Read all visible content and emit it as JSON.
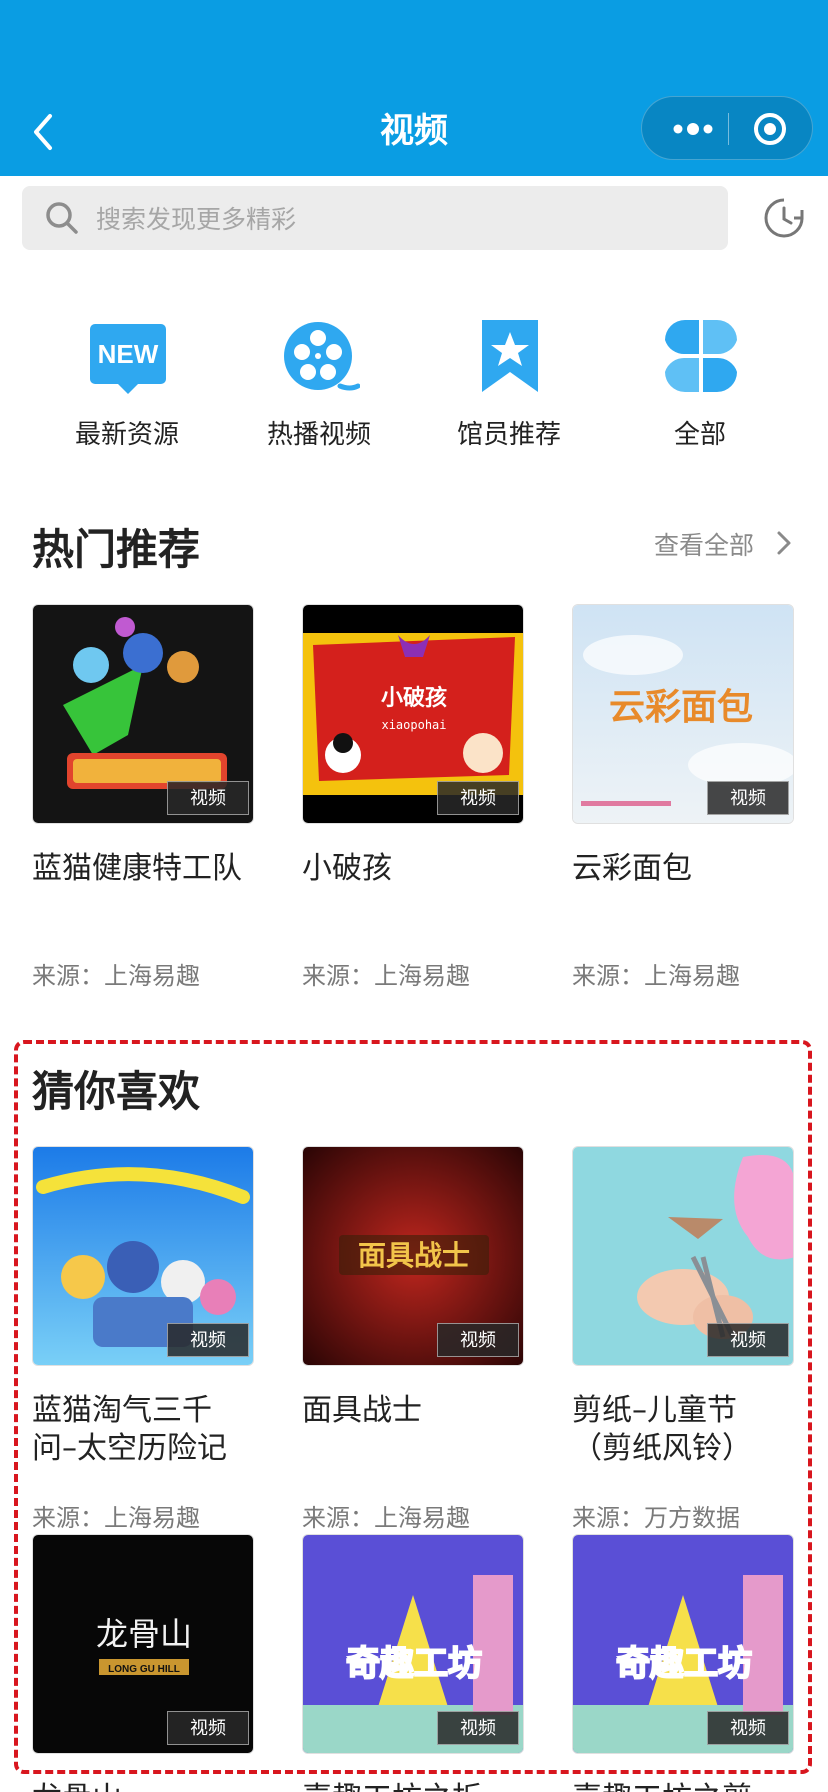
{
  "nav": {
    "title": "视频"
  },
  "search": {
    "placeholder": "搜索发现更多精彩"
  },
  "categories": [
    {
      "label": "最新资源",
      "icon": "new-badge-icon"
    },
    {
      "label": "热播视频",
      "icon": "film-reel-icon"
    },
    {
      "label": "馆员推荐",
      "icon": "star-bookmark-icon"
    },
    {
      "label": "全部",
      "icon": "grid-petals-icon"
    }
  ],
  "hot": {
    "title": "热门推荐",
    "see_all": "查看全部",
    "items": [
      {
        "title": "蓝猫健康特工队",
        "source": "来源：上海易趣",
        "badge": "视频"
      },
      {
        "title": "小破孩",
        "source": "来源：上海易趣",
        "badge": "视频",
        "thumb_text": "小破孩",
        "thumb_sub": "xiaopohai"
      },
      {
        "title": "云彩面包",
        "source": "来源：上海易趣",
        "badge": "视频",
        "thumb_text": "云彩面包"
      }
    ]
  },
  "guess": {
    "title": "猜你喜欢",
    "items": [
      {
        "title": "蓝猫淘气三千问–太空历险记",
        "source": "来源：上海易趣",
        "badge": "视频"
      },
      {
        "title": "面具战士",
        "source": "来源：上海易趣",
        "badge": "视频",
        "thumb_text": "面具战士"
      },
      {
        "title": "剪纸–儿童节（剪纸风铃）",
        "source": "来源：万方数据",
        "badge": "视频"
      },
      {
        "title": "龙骨山",
        "badge": "视频",
        "thumb_text": "龙骨山",
        "thumb_sub": "LONG GU HILL"
      },
      {
        "title": "喜趣工坊之折",
        "badge": "视频",
        "thumb_text": "奇趣工坊"
      },
      {
        "title": "喜趣工坊之剪",
        "badge": "视频",
        "thumb_text": "奇趣工坊"
      }
    ]
  },
  "colors": {
    "primary": "#0a9de3",
    "icon_blue": "#2fa8f0",
    "highlight_border": "#d8161e"
  }
}
